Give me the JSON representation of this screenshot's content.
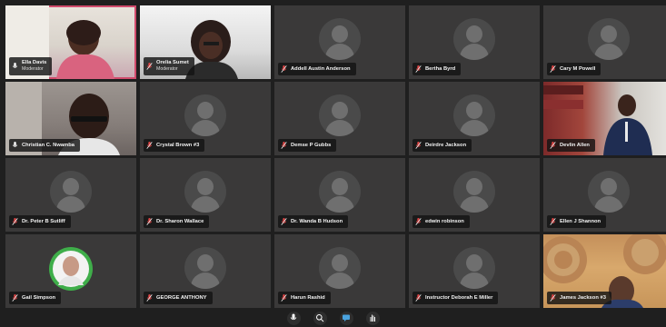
{
  "meeting": {
    "participants": [
      {
        "name": "Ella Davis",
        "role": "Moderator",
        "type": "video",
        "mic": "on"
      },
      {
        "name": "Orelia Sumet",
        "role": "Moderator",
        "type": "video",
        "mic": "muted"
      },
      {
        "name": "Addell Austin Anderson",
        "role": "",
        "type": "avatar",
        "mic": "muted"
      },
      {
        "name": "Bertha Byrd",
        "role": "",
        "type": "avatar",
        "mic": "muted"
      },
      {
        "name": "Cary M Powell",
        "role": "",
        "type": "avatar",
        "mic": "muted"
      },
      {
        "name": "Christian C. Nwamba",
        "role": "",
        "type": "video",
        "mic": "on"
      },
      {
        "name": "Crystal Brown #3",
        "role": "",
        "type": "avatar",
        "mic": "muted"
      },
      {
        "name": "Demse P Gubbs",
        "role": "",
        "type": "avatar",
        "mic": "muted"
      },
      {
        "name": "Deirdre Jackson",
        "role": "",
        "type": "avatar",
        "mic": "muted"
      },
      {
        "name": "Devlin Allen",
        "role": "",
        "type": "video",
        "mic": "muted"
      },
      {
        "name": "Dr. Peter B Sutliff",
        "role": "",
        "type": "avatar",
        "mic": "muted"
      },
      {
        "name": "Dr. Sharon Wallace",
        "role": "",
        "type": "avatar",
        "mic": "muted"
      },
      {
        "name": "Dr. Wanda B Hudson",
        "role": "",
        "type": "avatar",
        "mic": "muted"
      },
      {
        "name": "edwin robinson",
        "role": "",
        "type": "avatar",
        "mic": "muted"
      },
      {
        "name": "Ellen J Shannon",
        "role": "",
        "type": "avatar",
        "mic": "muted"
      },
      {
        "name": "Gail Simpson",
        "role": "",
        "type": "photo",
        "mic": "muted"
      },
      {
        "name": "GEORGE ANTHONY",
        "role": "",
        "type": "avatar",
        "mic": "muted"
      },
      {
        "name": "Harun Rashid",
        "role": "",
        "type": "avatar",
        "mic": "muted"
      },
      {
        "name": "Instructor Deborah E Miller",
        "role": "",
        "type": "avatar",
        "mic": "muted"
      },
      {
        "name": "James Jackson #3",
        "role": "",
        "type": "video",
        "mic": "muted"
      }
    ],
    "controls": [
      {
        "icon": "microphone-icon"
      },
      {
        "icon": "search-icon"
      },
      {
        "icon": "chat-icon"
      },
      {
        "icon": "raise-hand-icon"
      }
    ],
    "colors": {
      "background": "#1f1f1f",
      "tile": "#3a3939",
      "muted_icon": "#e04545",
      "active_speaker": "#d14b6c"
    }
  }
}
